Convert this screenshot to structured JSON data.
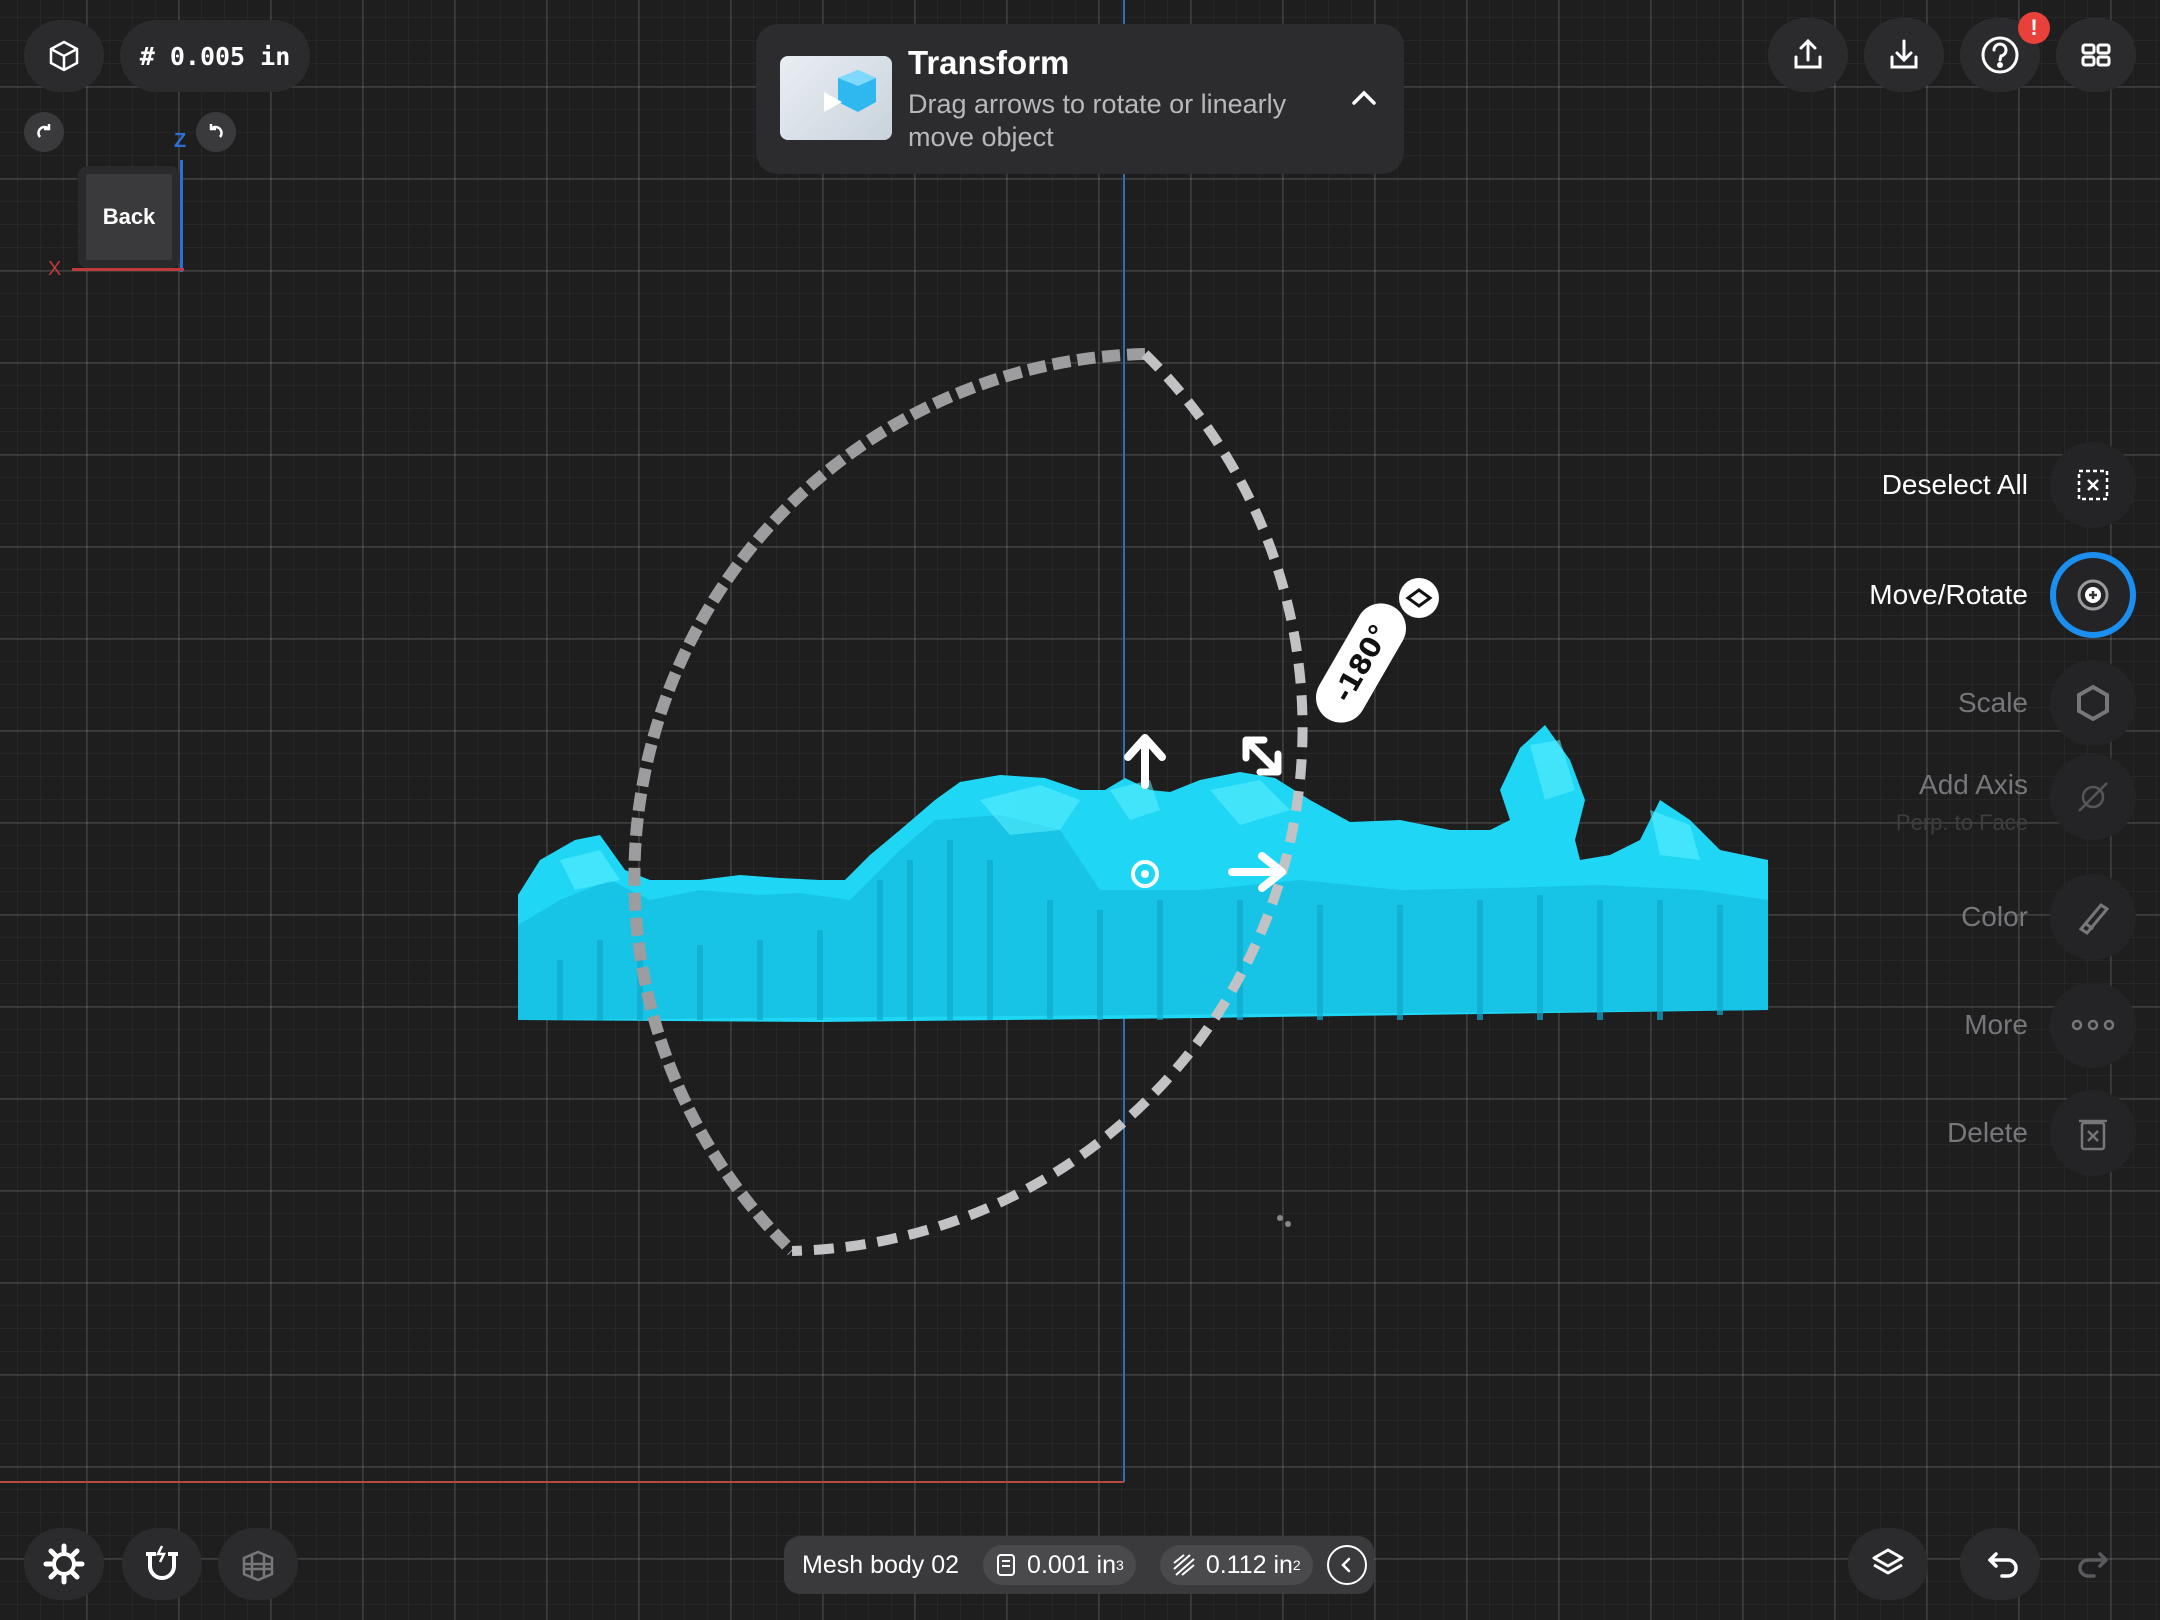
{
  "units": {
    "increment": "# 0.005 in"
  },
  "banner": {
    "title": "Transform",
    "subtitle": "Drag arrows to rotate or linearly move object"
  },
  "viewcube": {
    "face": "Back",
    "axis_z": "Z",
    "axis_x": "X"
  },
  "gizmo": {
    "angle": "-180°"
  },
  "right_menu": {
    "deselect_all": "Deselect All",
    "move_rotate": "Move/Rotate",
    "scale": "Scale",
    "add_axis": "Add Axis",
    "add_axis_sub": "Perp. to Face",
    "color": "Color",
    "more": "More",
    "delete": "Delete"
  },
  "status": {
    "name": "Mesh body 02",
    "volume": "0.001 in",
    "volume_exp": "3",
    "area": "0.112 in",
    "area_exp": "2"
  },
  "top_right": {
    "notification": "!"
  },
  "colors": {
    "model": "#1fd7f5",
    "accent": "#1a8ff0",
    "axis_z": "#2e6fae",
    "axis_x": "#b54a43"
  },
  "icons": [
    "cube-icon",
    "redo-icon",
    "undo-icon",
    "share-icon",
    "download-icon",
    "help-icon",
    "grid-icon",
    "deselect-icon",
    "move-rotate-icon",
    "scale-icon",
    "add-axis-icon",
    "color-icon",
    "more-icon",
    "delete-icon",
    "settings-icon",
    "magnet-icon",
    "layers-grid-icon",
    "layers-icon",
    "undo-arrow-icon",
    "redo-arrow-icon"
  ]
}
